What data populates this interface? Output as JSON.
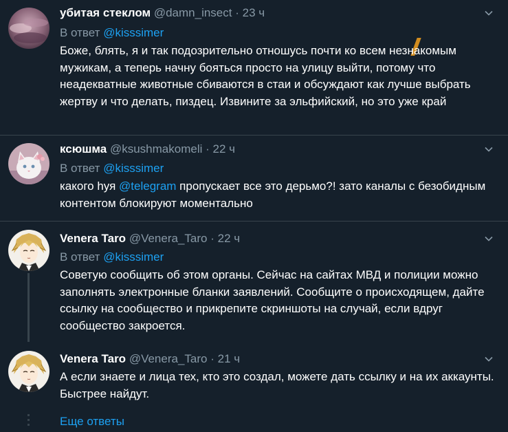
{
  "colors": {
    "background": "#15202b",
    "text": "#ffffff",
    "secondary": "#8899a6",
    "accent": "#1da1f2",
    "divider": "#38444d"
  },
  "tweets": [
    {
      "name": "убитая стеклом",
      "handle": "@damn_insect",
      "separator": "·",
      "time": "23 ч",
      "reply_prefix": "В ответ",
      "reply_mention": "@kisssimer",
      "text": "Боже, блять, я и так подозрительно отношусь почти ко всем незнакомым мужикам, а теперь начну бояться просто на улицу выйти, потому что неадекватные животные сбиваются в стаи и обсуждают как лучше выбрать жертву и что делать, пиздец. Извините за эльфийский, но это уже край",
      "avatar_icon": "purple-sky-avatar"
    },
    {
      "name": "ксюшма",
      "handle": "@ksushmakomeli",
      "separator": "·",
      "time": "22 ч",
      "reply_prefix": "В ответ",
      "reply_mention": "@kisssimer",
      "text_before": "какого hуя ",
      "text_mention": "@telegram",
      "text_after": " пропускает все это дерьмо?! зато каналы с безобидным контентом блокируют моментально",
      "avatar_icon": "white-cat-avatar"
    },
    {
      "name": "Venera Taro",
      "handle": "@Venera_Taro",
      "separator": "·",
      "time": "22 ч",
      "reply_prefix": "В ответ",
      "reply_mention": "@kisssimer",
      "text": "Советую сообщить об этом органы. Сейчас на сайтах МВД и полиции можно заполнять электронные бланки заявлений. Сообщите о происходящем, дайте ссылку на сообщество и прикрепите скриншоты на случай, если вдруг сообщество закроется.",
      "avatar_icon": "anime-portrait-avatar"
    },
    {
      "name": "Venera Taro",
      "handle": "@Venera_Taro",
      "separator": "·",
      "time": "21 ч",
      "text": "А если знаете и лица тех, кто это создал, можете дать ссылку и на их аккаунты. Быстрее найдут.",
      "avatar_icon": "anime-portrait-avatar"
    }
  ],
  "show_more": "Еще ответы"
}
